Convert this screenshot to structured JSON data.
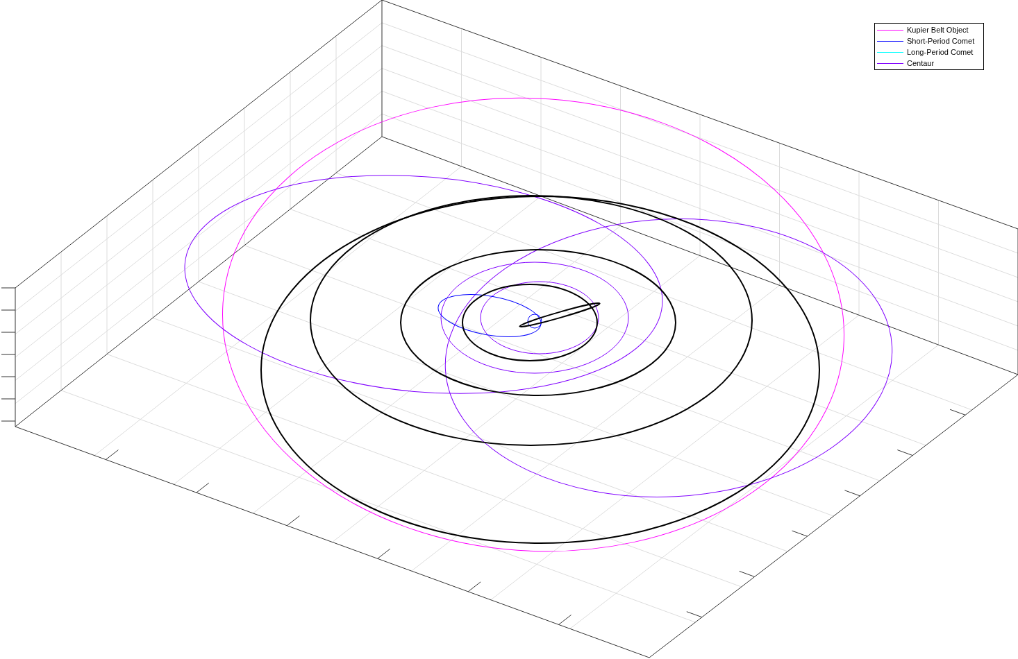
{
  "legend": [
    {
      "label": "Kupier Belt Object",
      "color": "#ff00ff"
    },
    {
      "label": "Short-Period Comet",
      "color": "#0000ff"
    },
    {
      "label": "Long-Period Comet",
      "color": "#00ffff"
    },
    {
      "label": "Centaur",
      "color": "#8000ff"
    }
  ]
}
